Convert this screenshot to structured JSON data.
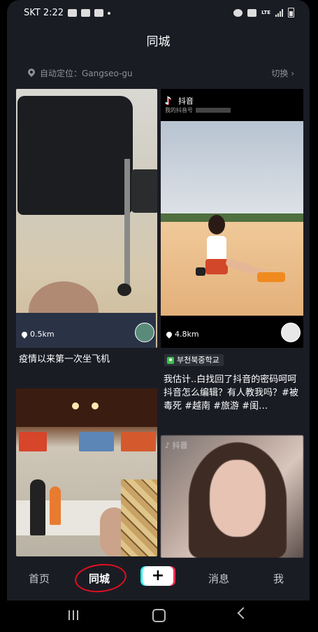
{
  "status": {
    "carrier_time": "SKT 2:22",
    "network": "LTE"
  },
  "header": {
    "title": "同城"
  },
  "location": {
    "label": "自动定位：Gangseo-gu",
    "switch_label": "切换"
  },
  "feed": {
    "card1": {
      "distance": "0.5km",
      "caption": "疫情以来第一次坐飞机"
    },
    "card2": {
      "watermark_app": "抖音",
      "watermark_id": "我的抖音号",
      "distance": "4.8km",
      "poi_badge": "부천북중학교",
      "caption": "我估计..白找回了抖音的密码呵呵 抖音怎么编辑？有人教我吗？#被毒死 #越南 #旅游 #闺…"
    },
    "card4": {
      "watermark_app": "抖音"
    }
  },
  "tabbar": {
    "home": "首页",
    "nearby": "同城",
    "create": "+",
    "messages": "消息",
    "me": "我"
  },
  "colors": {
    "background": "#1a1c24",
    "annotation_circle": "#e3101f",
    "poi_badge": "#3fbf4f"
  }
}
